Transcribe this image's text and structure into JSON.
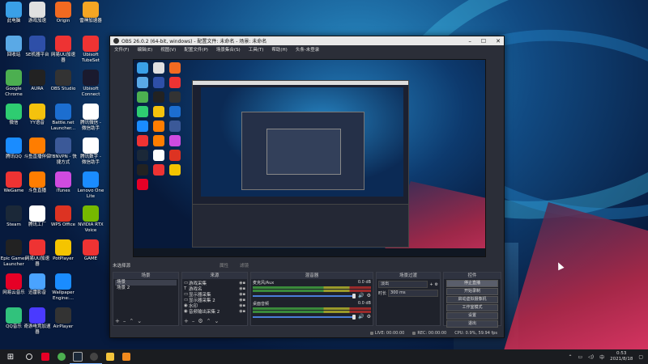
{
  "desktop": {
    "icons": [
      {
        "label": "此电脑",
        "color": "#3aa0e8"
      },
      {
        "label": "游戏加速",
        "color": "#e0e0e0"
      },
      {
        "label": "Origin",
        "color": "#f26a21"
      },
      {
        "label": "雷神加速器",
        "color": "#f5a623"
      },
      {
        "label": "回收站",
        "color": "#5aa9e6"
      },
      {
        "label": "SE机器平台",
        "color": "#2e4fa8"
      },
      {
        "label": "网易UU加速器",
        "color": "#e33"
      },
      {
        "label": "Ubisoft\nTubeSet",
        "color": "#e33"
      },
      {
        "label": "Google\nChrome",
        "color": "#4caf50"
      },
      {
        "label": "AURA",
        "color": "#222"
      },
      {
        "label": "OBS Studio",
        "color": "#333"
      },
      {
        "label": "Ubisoft\nConnect",
        "color": "#1a1a2e"
      },
      {
        "label": "微信",
        "color": "#2ecc71"
      },
      {
        "label": "YY语音",
        "color": "#f4c20d"
      },
      {
        "label": "Battle.net\nLauncher...",
        "color": "#1c6ed0"
      },
      {
        "label": "腾讯微信 -\n微信助手",
        "color": "#fff"
      },
      {
        "label": "腾讯QQ",
        "color": "#1a8cff"
      },
      {
        "label": "斗鱼直播伴侣",
        "color": "#ff7d00"
      },
      {
        "label": "TBNVPN - 快\n捷方式",
        "color": "#3b5998"
      },
      {
        "label": "腾讯数字 -\n微信助手",
        "color": "#fff"
      },
      {
        "label": "WeGame",
        "color": "#e33"
      },
      {
        "label": "斗鱼直播",
        "color": "#ff7d00"
      },
      {
        "label": "iTunes",
        "color": "#d04be0"
      },
      {
        "label": "Lenovo One\nLite",
        "color": "#1a8cff"
      },
      {
        "label": "Steam",
        "color": "#1b2838"
      },
      {
        "label": "腾讯工厂",
        "color": "#fff"
      },
      {
        "label": "WPS Office",
        "color": "#d32"
      },
      {
        "label": "NVIDIA RTX\nVoice",
        "color": "#76b900"
      },
      {
        "label": "Epic Games\nLauncher",
        "color": "#222"
      },
      {
        "label": "网易UU加速器",
        "color": "#e33"
      },
      {
        "label": "PotPlayer",
        "color": "#f5c400"
      },
      {
        "label": "GAME",
        "color": "#e33"
      },
      {
        "label": "网易云音乐",
        "color": "#e60026"
      },
      {
        "label": "迅雷影音",
        "color": "#4aa3ff"
      },
      {
        "label": "Wallpaper\nEngine:...",
        "color": "#1a8cff"
      },
      {
        "label": "",
        "color": "transparent"
      },
      {
        "label": "QQ音乐",
        "color": "#31c27c"
      },
      {
        "label": "奇游电竞加速器",
        "color": "#4a3aff"
      },
      {
        "label": "AirPlayer",
        "color": "#333"
      }
    ]
  },
  "obs": {
    "title": "OBS 26.0.2 (64-bit, windows) - 配置文件: 未命名 - 场景: 未命名",
    "menu": [
      "文件(F)",
      "编辑(E)",
      "视图(V)",
      "配置文件(P)",
      "场景集合(S)",
      "工具(T)",
      "帮助(H)",
      "头条-未登录"
    ],
    "mode_row": {
      "scene_label": "未选择源",
      "mode_a": "属性",
      "mode_b": "滤镜"
    },
    "scenes": {
      "header": "场景",
      "items": [
        "场景",
        "场景 2"
      ]
    },
    "sources": {
      "header": "来源",
      "items": [
        {
          "icon": "▭",
          "name": "游戏采集"
        },
        {
          "icon": "T",
          "name": "游戏名"
        },
        {
          "icon": "▭",
          "name": "显示器采集"
        },
        {
          "icon": "▭",
          "name": "显示器采集 2"
        },
        {
          "icon": "◉",
          "name": "水印"
        },
        {
          "icon": "◉",
          "name": "音频输出采集 2"
        }
      ]
    },
    "mixer": {
      "header": "混音器",
      "channels": [
        {
          "name": "麦克风/Aux",
          "level": "0.0 dB"
        },
        {
          "name": "桌面音频",
          "level": "0.0 dB"
        }
      ]
    },
    "transitions": {
      "header": "场景过渡",
      "type": "淡出",
      "duration_label": "时长",
      "duration": "300 ms"
    },
    "controls": {
      "header": "控件",
      "buttons": [
        "停止直播",
        "开始录制",
        "启动虚拟摄像机",
        "工作室模式",
        "设置",
        "退出"
      ]
    },
    "status": {
      "live_label": "LIVE:",
      "live_time": "00:00:00",
      "rec_label": "REC:",
      "rec_time": "00:00:00",
      "cpu": "CPU: 0.9%, 59.94 fps"
    }
  },
  "taskbar": {
    "time": "0:53",
    "date": "2021/8/18",
    "lang": "中"
  }
}
